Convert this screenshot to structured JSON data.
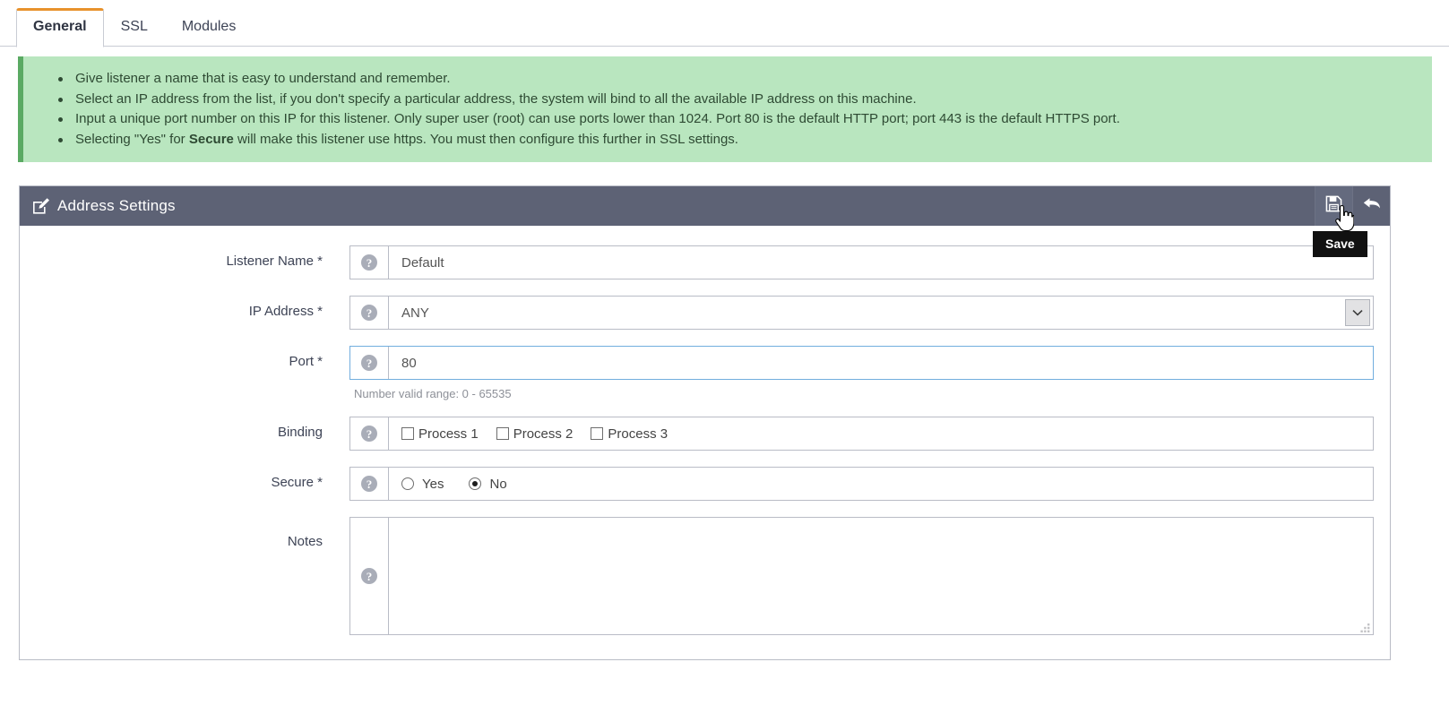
{
  "tabs": [
    {
      "label": "General",
      "active": true
    },
    {
      "label": "SSL",
      "active": false
    },
    {
      "label": "Modules",
      "active": false
    }
  ],
  "info": {
    "bullets": [
      "Give listener a name that is easy to understand and remember.",
      "Select an IP address from the list, if you don't specify a particular address, the system will bind to all the available IP address on this machine.",
      "Input a unique port number on this IP for this listener. Only super user (root) can use ports lower than 1024. Port 80 is the default HTTP port; port 443 is the default HTTPS port.",
      "Selecting \"Yes\" for Secure will make this listener use https. You must then configure this further in SSL settings."
    ],
    "bullet4_prefix": "Selecting \"Yes\" for ",
    "bullet4_bold": "Secure",
    "bullet4_suffix": " will make this listener use https. You must then configure this further in SSL settings.",
    "background_color": "#b9e6bf",
    "accent_color": "#5aaa63"
  },
  "panel": {
    "title": "Address Settings",
    "header_color": "#5d6275",
    "edit_icon": "edit-pencil-icon",
    "actions": [
      {
        "name": "save-button",
        "icon": "floppy-disk-icon",
        "tooltip": "Save"
      },
      {
        "name": "revert-button",
        "icon": "undo-arrow-icon",
        "tooltip": ""
      }
    ]
  },
  "tooltip": {
    "text": "Save"
  },
  "form": {
    "listener_name": {
      "label": "Listener Name *",
      "value": "Default",
      "placeholder": ""
    },
    "ip_address": {
      "label": "IP Address *",
      "value": "ANY",
      "options": [
        "ANY"
      ]
    },
    "port": {
      "label": "Port *",
      "value": "80",
      "hint": "Number valid range: 0 - 65535",
      "focused": true
    },
    "binding": {
      "label": "Binding",
      "options": [
        {
          "label": "Process 1",
          "checked": false
        },
        {
          "label": "Process 2",
          "checked": false
        },
        {
          "label": "Process 3",
          "checked": false
        }
      ]
    },
    "secure": {
      "label": "Secure *",
      "options": [
        {
          "label": "Yes",
          "checked": false
        },
        {
          "label": "No",
          "checked": true
        }
      ]
    },
    "notes": {
      "label": "Notes",
      "value": "",
      "placeholder": ""
    }
  }
}
